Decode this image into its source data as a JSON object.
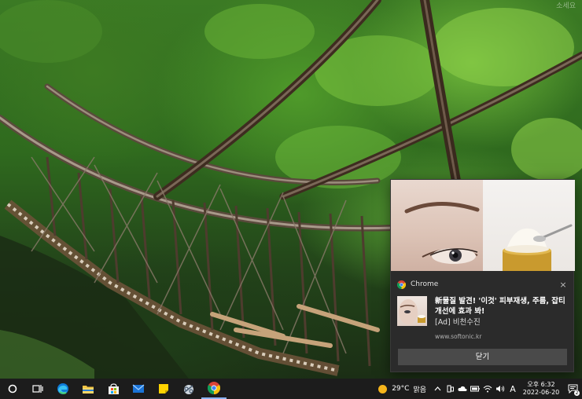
{
  "desktop": {
    "watermark": "소세요"
  },
  "toast": {
    "app_name": "Chrome",
    "close_glyph": "×",
    "title": "新물질 발견! '이것' 피부재생, 주름, 잡티 개선에 효과 봐!",
    "subtitle": "[Ad] 비천수진",
    "url": "www.softonic.kr",
    "button_label": "닫기"
  },
  "taskbar": {
    "items": [
      {
        "name": "start",
        "icon": "cortana-circle-icon"
      },
      {
        "name": "task-view",
        "icon": "task-view-icon"
      },
      {
        "name": "edge",
        "icon": "edge-icon"
      },
      {
        "name": "file-explorer",
        "icon": "folder-icon"
      },
      {
        "name": "store",
        "icon": "store-icon"
      },
      {
        "name": "mail",
        "icon": "mail-icon"
      },
      {
        "name": "sticky-notes",
        "icon": "sticky-notes-icon"
      },
      {
        "name": "snipping",
        "icon": "snipping-tool-icon"
      },
      {
        "name": "chrome",
        "icon": "chrome-icon",
        "active": true
      }
    ],
    "weather": {
      "temp": "29°C",
      "condition": "맑음"
    },
    "input_indicator": "A",
    "clock": {
      "time": "오후 6:32",
      "date": "2022-06-20"
    },
    "notification_count": "2"
  },
  "colors": {
    "taskbar_bg": "#1c1c1c",
    "toast_bg": "#2b2b2b",
    "button_bg": "#4a4a4a",
    "accent": "#8ab4f8"
  }
}
